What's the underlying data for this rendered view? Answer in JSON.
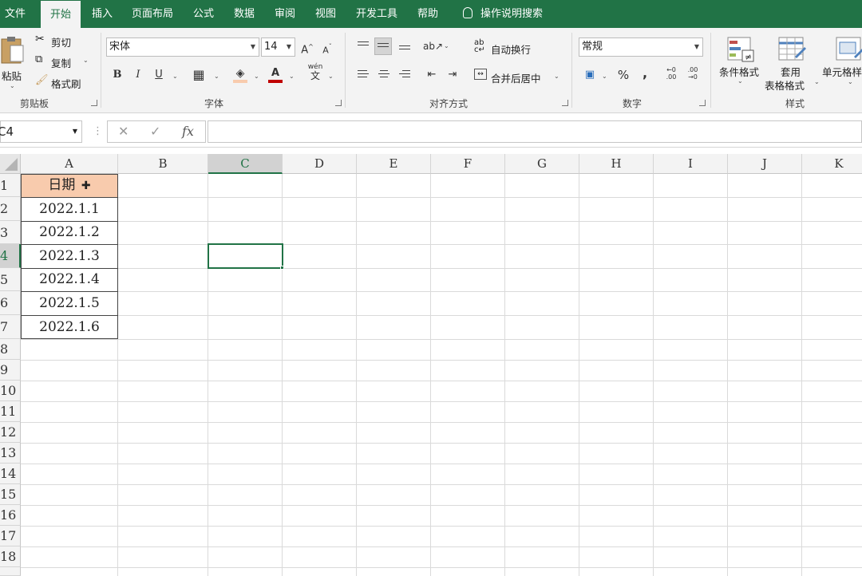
{
  "tabs": [
    "文件",
    "开始",
    "插入",
    "页面布局",
    "公式",
    "数据",
    "审阅",
    "视图",
    "开发工具",
    "帮助"
  ],
  "tell_me": "操作说明搜索",
  "clipboard": {
    "paste": "粘贴",
    "cut": "剪切",
    "copy": "复制",
    "format_painter": "格式刷",
    "label": "剪贴板"
  },
  "font": {
    "name": "宋体",
    "size": "14",
    "label": "字体",
    "grow": "A",
    "shrink": "A",
    "bold": "B",
    "italic": "I",
    "underline": "U",
    "font_color": "A",
    "phonetic_top": "wén",
    "phonetic_bottom": "文"
  },
  "alignment": {
    "wrap": "自动换行",
    "merge": "合并后居中",
    "label": "对齐方式"
  },
  "number": {
    "format": "常规",
    "percent": "%",
    "comma": ",",
    "label": "数字"
  },
  "styles": {
    "conditional": "条件格式",
    "table_line1": "套用",
    "table_line2": "表格格式",
    "cell_styles": "单元格样",
    "label": "样式"
  },
  "formula_bar": {
    "name_box": "C4",
    "cancel": "✕",
    "enter": "✓",
    "fx": "fx",
    "value": ""
  },
  "columns": [
    "A",
    "B",
    "C",
    "D",
    "E",
    "F",
    "G",
    "H",
    "I",
    "J",
    "K"
  ],
  "rows": [
    "1",
    "2",
    "3",
    "4",
    "5",
    "6",
    "7",
    "8",
    "9",
    "10",
    "11",
    "12",
    "13",
    "14",
    "15",
    "16",
    "17",
    "18"
  ],
  "cells": {
    "A1": "日期",
    "A2": "2022.1.1",
    "A3": "2022.1.2",
    "A4": "2022.1.3",
    "A5": "2022.1.4",
    "A6": "2022.1.5",
    "A7": "2022.1.6"
  },
  "active_cell": "C4",
  "colors": {
    "accent": "#217346",
    "header_fill": "#f8cbad"
  }
}
